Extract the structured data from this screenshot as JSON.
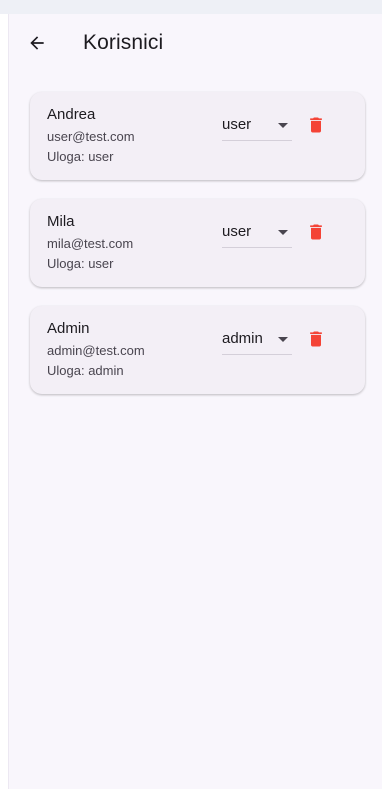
{
  "app_bar": {
    "title": "Korisnici",
    "back_icon": "arrow-back-icon"
  },
  "colors": {
    "delete": "#f44336",
    "background": "#f9f6fc",
    "card": "#f3eff6"
  },
  "users": [
    {
      "name": "Andrea",
      "email": "user@test.com",
      "role_line": "Uloga: user",
      "role_value": "user"
    },
    {
      "name": "Mila",
      "email": "mila@test.com",
      "role_line": "Uloga: user",
      "role_value": "user"
    },
    {
      "name": "Admin",
      "email": "admin@test.com",
      "role_line": "Uloga: admin",
      "role_value": "admin"
    }
  ]
}
